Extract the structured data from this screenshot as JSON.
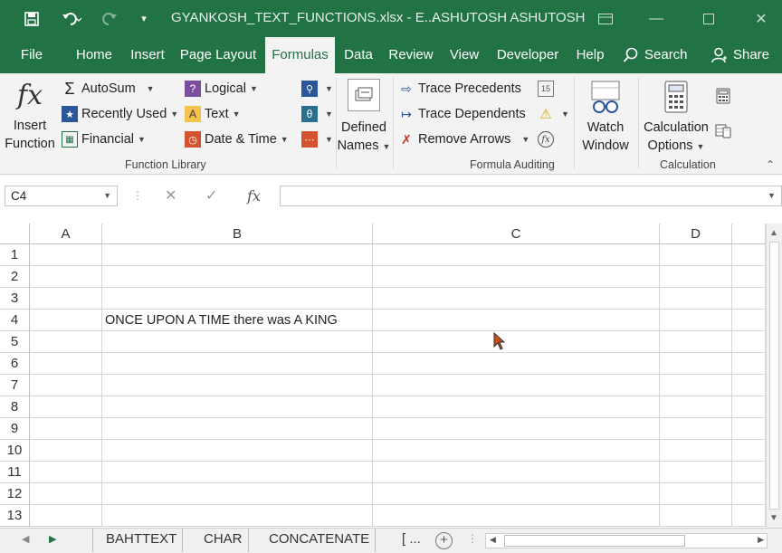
{
  "titlebar": {
    "filename": "GYANKOSH_TEXT_FUNCTIONS.xlsx  -  E...",
    "user": "ASHUTOSH ASHUTOSH",
    "save_icon": "save-icon",
    "undo_icon": "undo-icon",
    "redo_icon": "redo-icon"
  },
  "tabs": [
    {
      "label": "File"
    },
    {
      "label": "Home"
    },
    {
      "label": "Insert"
    },
    {
      "label": "Page Layout"
    },
    {
      "label": "Formulas"
    },
    {
      "label": "Data"
    },
    {
      "label": "Review"
    },
    {
      "label": "View"
    },
    {
      "label": "Developer"
    },
    {
      "label": "Help"
    }
  ],
  "search": {
    "label": "Search"
  },
  "share": {
    "label": "Share"
  },
  "ribbon": {
    "insert_function": {
      "line1": "Insert",
      "line2": "Function"
    },
    "autosum": "AutoSum",
    "recently_used": "Recently Used",
    "financial": "Financial",
    "logical": "Logical",
    "text": "Text",
    "date_time": "Date & Time",
    "defined_names": {
      "line1": "Defined",
      "line2": "Names"
    },
    "trace_precedents": "Trace Precedents",
    "trace_dependents": "Trace Dependents",
    "remove_arrows": "Remove Arrows",
    "watch_window": {
      "line1": "Watch",
      "line2": "Window"
    },
    "calculation_options": {
      "line1": "Calculation",
      "line2": "Options"
    },
    "groups": {
      "function_library": "Function Library",
      "formula_auditing": "Formula Auditing",
      "calculation": "Calculation"
    }
  },
  "formula_bar": {
    "name_box": "C4",
    "formula": ""
  },
  "grid": {
    "columns": [
      "A",
      "B",
      "C",
      "D"
    ],
    "rows": [
      "1",
      "2",
      "3",
      "4",
      "5",
      "6",
      "7",
      "8",
      "9",
      "10",
      "11",
      "12",
      "13"
    ],
    "cells": {
      "B4": "ONCE UPON A TIME there was  A KING"
    }
  },
  "sheets": {
    "tabs": [
      "BAHTTEXT",
      "CHAR",
      "CONCATENATE",
      "[ ..."
    ]
  },
  "colors": {
    "accent": "#217346",
    "ribbon_bg": "#f3f3f3"
  }
}
